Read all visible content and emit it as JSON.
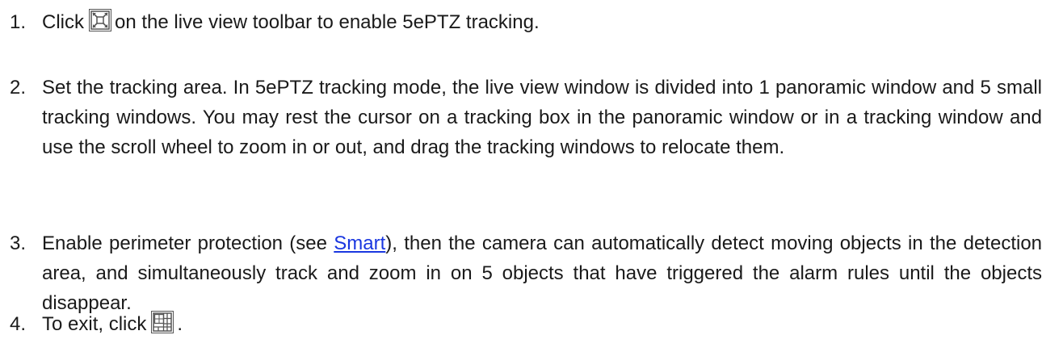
{
  "steps": [
    {
      "number": "1.",
      "before_icon": "Click",
      "icon": "5ptz-tracking-icon",
      "after_icon": "on the live view toolbar to enable 5ePTZ tracking."
    },
    {
      "number": "2.",
      "text": "Set the tracking area. In 5ePTZ tracking mode, the live view window is divided into 1 panoramic window and 5 small tracking windows. You may rest the cursor on a tracking box in the panoramic window or in a tracking window and use the scroll wheel to zoom in or out, and drag the tracking windows to relocate them."
    },
    {
      "number": "3.",
      "before_link": "Enable perimeter protection (see",
      "link": "Smart",
      "after_link": "), then the camera can automatically detect moving objects in the detection area, and simultaneously track and zoom in on 5 objects that have triggered the alarm rules until the objects disappear."
    },
    {
      "number": "4.",
      "before_icon": "To exit, click",
      "icon": "exit-tracking-grid-icon",
      "after_icon": "."
    }
  ],
  "colors": {
    "text": "#1a1a1a",
    "link": "#1a37e0",
    "icon_border": "#555555"
  }
}
